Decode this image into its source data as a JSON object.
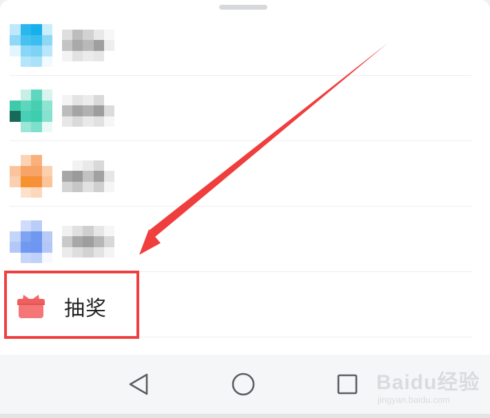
{
  "sheet": {
    "items": [
      {
        "kind": "blurred-app",
        "accent": "#2fb8f0"
      },
      {
        "kind": "blurred-app",
        "accent": "#3fd1b4"
      },
      {
        "kind": "blurred-app",
        "accent": "#f7953f"
      },
      {
        "kind": "blurred-app",
        "accent": "#6e9cf2"
      }
    ],
    "lottery": {
      "label": "抽奖",
      "icon": "gift-icon",
      "icon_color": "#f26b6b"
    }
  },
  "annotation": {
    "color": "#f03e3e"
  },
  "navbar": {
    "buttons": [
      "back-icon",
      "home-icon",
      "recents-icon"
    ]
  },
  "watermark": {
    "text": "Baidu经验",
    "sub": "jingyan.baidu.com"
  }
}
